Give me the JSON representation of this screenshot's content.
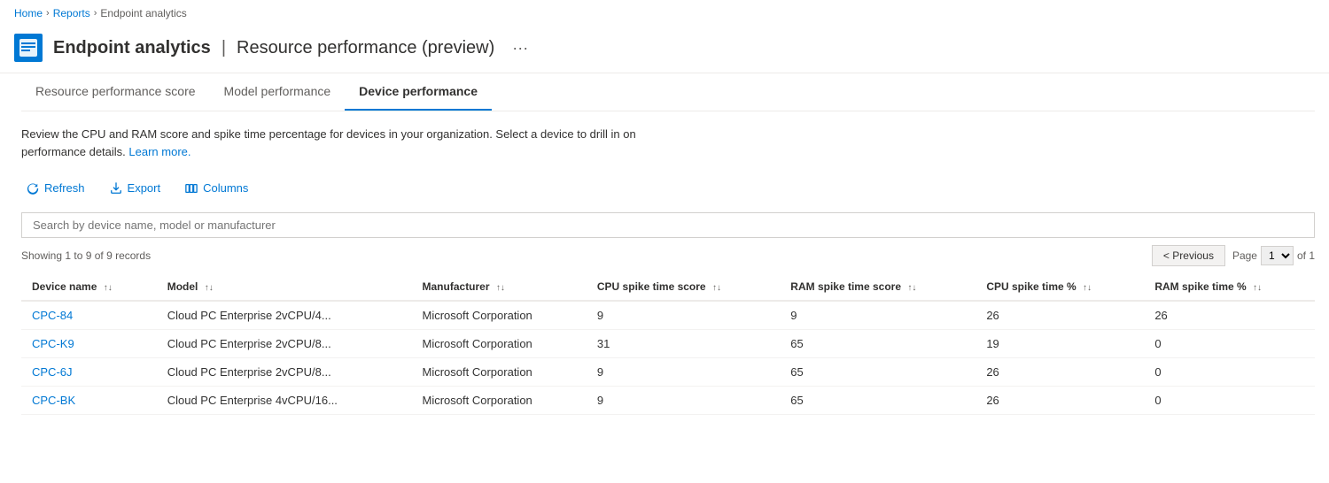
{
  "breadcrumb": {
    "home": "Home",
    "reports": "Reports",
    "current": "Endpoint analytics"
  },
  "header": {
    "title": "Endpoint analytics",
    "separator": "|",
    "subtitle": "Resource performance (preview)",
    "more_icon": "···"
  },
  "tabs": [
    {
      "id": "resource-performance-score",
      "label": "Resource performance score",
      "active": false
    },
    {
      "id": "model-performance",
      "label": "Model performance",
      "active": false
    },
    {
      "id": "device-performance",
      "label": "Device performance",
      "active": true
    }
  ],
  "description": {
    "text": "Review the CPU and RAM score and spike time percentage for devices in your organization. Select a device to drill in on performance details.",
    "link_text": "Learn more."
  },
  "toolbar": {
    "refresh_label": "Refresh",
    "export_label": "Export",
    "columns_label": "Columns"
  },
  "search": {
    "placeholder": "Search by device name, model or manufacturer"
  },
  "table_info": {
    "showing": "Showing 1 to 9 of 9 records",
    "page_label": "Page",
    "of_label": "of 1",
    "current_page": "1"
  },
  "pagination": {
    "previous_label": "< Previous"
  },
  "columns": [
    {
      "id": "device-name",
      "label": "Device name"
    },
    {
      "id": "model",
      "label": "Model"
    },
    {
      "id": "manufacturer",
      "label": "Manufacturer"
    },
    {
      "id": "cpu-spike-score",
      "label": "CPU spike time score"
    },
    {
      "id": "ram-spike-score",
      "label": "RAM spike time score"
    },
    {
      "id": "cpu-spike-pct",
      "label": "CPU spike time %"
    },
    {
      "id": "ram-spike-pct",
      "label": "RAM spike time %"
    }
  ],
  "rows": [
    {
      "device": "CPC-84",
      "model": "Cloud PC Enterprise 2vCPU/4...",
      "manufacturer": "Microsoft Corporation",
      "cpu_score": "9",
      "ram_score": "9",
      "cpu_pct": "26",
      "ram_pct": "26"
    },
    {
      "device": "CPC-K9",
      "model": "Cloud PC Enterprise 2vCPU/8...",
      "manufacturer": "Microsoft Corporation",
      "cpu_score": "31",
      "ram_score": "65",
      "cpu_pct": "19",
      "ram_pct": "0"
    },
    {
      "device": "CPC-6J",
      "model": "Cloud PC Enterprise 2vCPU/8...",
      "manufacturer": "Microsoft Corporation",
      "cpu_score": "9",
      "ram_score": "65",
      "cpu_pct": "26",
      "ram_pct": "0"
    },
    {
      "device": "CPC-BK",
      "model": "Cloud PC Enterprise 4vCPU/16...",
      "manufacturer": "Microsoft Corporation",
      "cpu_score": "9",
      "ram_score": "65",
      "cpu_pct": "26",
      "ram_pct": "0"
    }
  ]
}
